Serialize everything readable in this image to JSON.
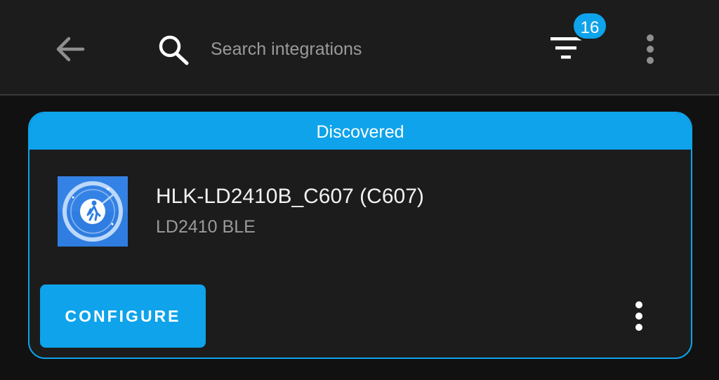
{
  "toolbar": {
    "search": {
      "placeholder": "Search integrations",
      "value": ""
    },
    "filter_count": "16"
  },
  "discovered_card": {
    "header": "Discovered",
    "device": {
      "name": "HLK-LD2410B_C607 (C607)",
      "integration": "LD2410 BLE"
    },
    "configure_label": "CONFIGURE"
  },
  "colors": {
    "accent": "#0ea3ea",
    "surface": "#1c1c1c",
    "background": "#111111",
    "muted_text": "#9a9a9a"
  },
  "icons": [
    "arrow-left-icon",
    "search-icon",
    "filter-icon",
    "dots-vertical-icon",
    "radar-person-icon"
  ]
}
